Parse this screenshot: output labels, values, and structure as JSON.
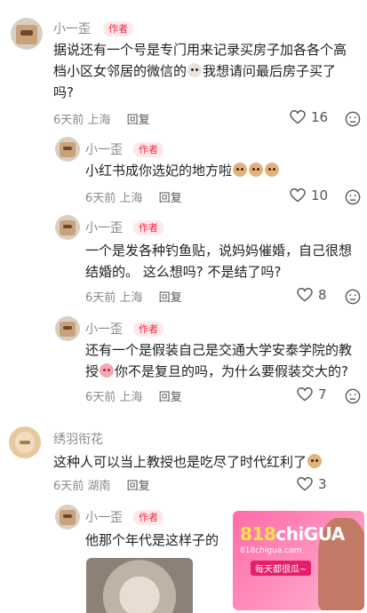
{
  "comments": [
    {
      "author": "小一歪",
      "badge": "作者",
      "text_parts": [
        "据说还有一个号是专门用来记录买房子加各各个高档小区女邻居的微信的",
        "我想请问最后房子买了吗?"
      ],
      "emoji_name": "cow-emoji",
      "time": "6天前",
      "location": "上海",
      "reply_label": "回复",
      "likes": "16"
    },
    {
      "author": "小一歪",
      "badge": "作者",
      "text_parts": [
        "小红书成你选妃的地方啦"
      ],
      "emoji_name": "dog-emoji",
      "time": "6天前",
      "location": "上海",
      "reply_label": "回复",
      "likes": "10"
    },
    {
      "author": "小一歪",
      "badge": "作者",
      "text_parts": [
        "一个是发各种钓鱼贴，说妈妈催婚，自己很想结婚的。 这么想吗? 不是结了吗?"
      ],
      "time": "6天前",
      "location": "上海",
      "reply_label": "回复",
      "likes": "8"
    },
    {
      "author": "小一歪",
      "badge": "作者",
      "text_parts": [
        "还有一个是假装自己是交通大学安泰学院的教授",
        "你不是复旦的吗，为什么要假装交大的?"
      ],
      "emoji_name": "pig-emoji",
      "time": "6天前",
      "location": "上海",
      "reply_label": "回复",
      "likes": "7"
    },
    {
      "author": "绣羽衔花",
      "text_parts": [
        "这种人可以当上教授也是吃尽了时代红利了"
      ],
      "emoji_name": "cry-emoji",
      "time": "6天前",
      "location": "湖南",
      "reply_label": "回复",
      "likes": "3"
    },
    {
      "author": "小一歪",
      "badge": "作者",
      "text_parts": [
        "他那个年代是这样子的"
      ]
    }
  ],
  "watermark": {
    "logo_num": "818",
    "logo_text": "chiGUA",
    "site": "818chigua.com",
    "slogan": "每天都很瓜~"
  },
  "colors": {
    "badge": "#ff2442",
    "meta": "#8a8a8a"
  }
}
